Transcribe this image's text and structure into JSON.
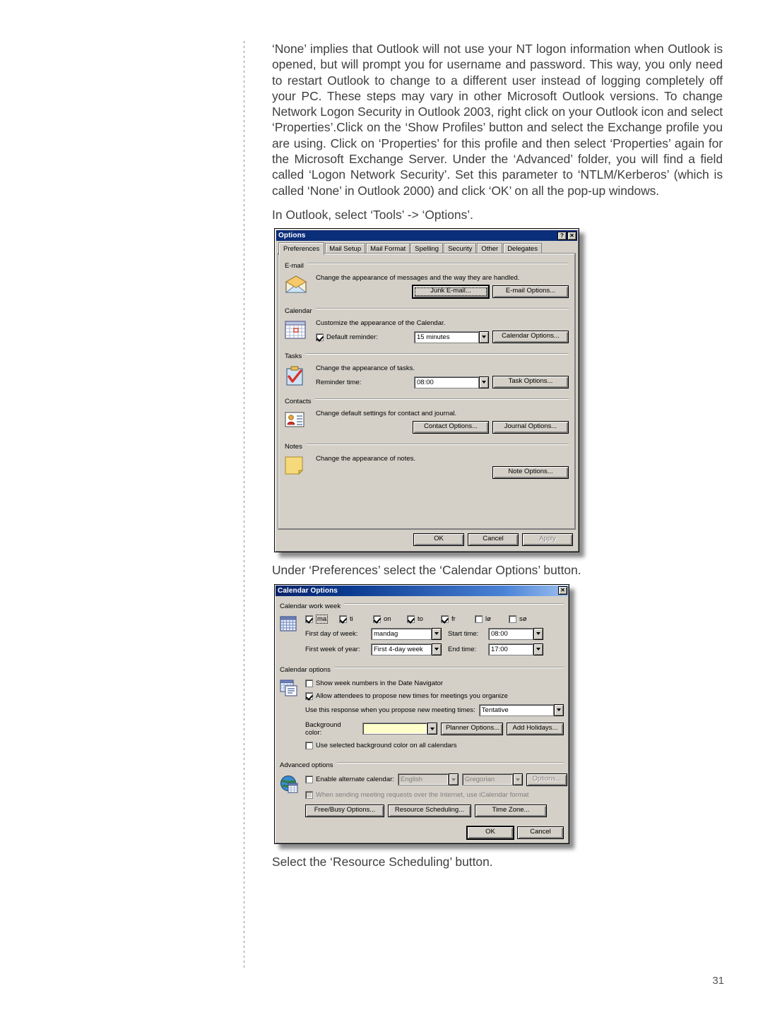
{
  "page": {
    "number": "31",
    "paragraphs": [
      "‘None’ implies that Outlook will not use your NT logon information when Outlook is opened, but will prompt you for username and password. This way, you only need to restart Outlook to change to a different user instead of logging completely off your PC. These steps may vary in other Microsoft Outlook versions. To change Network Logon Security in Outlook 2003, right click on your Outlook icon and select ‘Properties’.Click on the ‘Show Profiles’ button and select the Exchange profile you are using. Click on ‘Properties’ for this profile and then select ‘Properties’ again for the Microsoft Exchange Server. Under the ‘Advanced’ folder, you will find a field called ‘Logon Network Security’. Set this parameter to ‘NTLM/Kerberos’ (which is called ‘None’ in Outlook 2000) and click ‘OK’ on all the pop-up windows."
    ],
    "caption_before_options": "In Outlook, select ‘Tools’ -> ‘Options’.",
    "caption_between": "Under ‘Preferences’ select the ‘Calendar Options’ button.",
    "caption_after": "Select the ‘Resource Scheduling’ button."
  },
  "colors": {
    "title_navy": "#0b2e7a",
    "title_gradient_start": "#0a246a",
    "title_gradient_end": "#9cc0f0",
    "dialog_face": "#d4d0c8",
    "background_color_swatch": "#ffffcc"
  },
  "options_dialog": {
    "title": "Options",
    "titlebar_buttons": [
      {
        "name": "help-button",
        "glyph": "?"
      },
      {
        "name": "close-button",
        "glyph": "✕"
      }
    ],
    "tabs": [
      {
        "label": "Preferences",
        "selected": true
      },
      {
        "label": "Mail Setup",
        "selected": false
      },
      {
        "label": "Mail Format",
        "selected": false
      },
      {
        "label": "Spelling",
        "selected": false
      },
      {
        "label": "Security",
        "selected": false
      },
      {
        "label": "Other",
        "selected": false
      },
      {
        "label": "Delegates",
        "selected": false
      }
    ],
    "email": {
      "group_label": "E-mail",
      "description": "Change the appearance of messages and the way they are handled.",
      "junk_button": "Junk E-mail...",
      "email_options_button": "E-mail Options..."
    },
    "calendar": {
      "group_label": "Calendar",
      "description": "Customize the appearance of the Calendar.",
      "default_reminder_label": "Default reminder:",
      "default_reminder_checked": true,
      "default_reminder_value": "15 minutes",
      "calendar_options_button": "Calendar Options..."
    },
    "tasks": {
      "group_label": "Tasks",
      "description": "Change the appearance of tasks.",
      "reminder_time_label": "Reminder time:",
      "reminder_time_value": "08:00",
      "task_options_button": "Task Options..."
    },
    "contacts": {
      "group_label": "Contacts",
      "description": "Change default settings for contact and journal.",
      "contact_options_button": "Contact Options...",
      "journal_options_button": "Journal Options..."
    },
    "notes": {
      "group_label": "Notes",
      "description": "Change the appearance of notes.",
      "note_options_button": "Note Options..."
    },
    "footer": {
      "ok": "OK",
      "cancel": "Cancel",
      "apply": "Apply",
      "apply_disabled": true
    }
  },
  "calendar_options_dialog": {
    "title": "Calendar Options",
    "titlebar_buttons": [
      {
        "name": "close-button",
        "glyph": "✕"
      }
    ],
    "work_week": {
      "group_label": "Calendar work week",
      "days": [
        {
          "label": "ma",
          "checked": true,
          "focused": true
        },
        {
          "label": "ti",
          "checked": true,
          "focused": false
        },
        {
          "label": "on",
          "checked": true,
          "focused": false
        },
        {
          "label": "to",
          "checked": true,
          "focused": false
        },
        {
          "label": "fr",
          "checked": true,
          "focused": false
        },
        {
          "label": "lø",
          "checked": false,
          "focused": false
        },
        {
          "label": "sø",
          "checked": false,
          "focused": false
        }
      ],
      "first_day_label": "First day of week:",
      "first_day_value": "mandag",
      "start_time_label": "Start time:",
      "start_time_value": "08:00",
      "first_week_label": "First week of year:",
      "first_week_value": "First 4-day week",
      "end_time_label": "End time:",
      "end_time_value": "17:00"
    },
    "calendar_options": {
      "group_label": "Calendar options",
      "show_week_numbers_label": "Show week numbers in the Date Navigator",
      "show_week_numbers_checked": false,
      "allow_attendees_label": "Allow attendees to propose new times for meetings you organize",
      "allow_attendees_checked": true,
      "response_label": "Use this response when you propose new meeting times:",
      "response_value": "Tentative",
      "background_color_label": "Background color:",
      "background_color_value": "",
      "planner_options_button": "Planner Options...",
      "add_holidays_button": "Add Holidays...",
      "use_selected_bg_label": "Use selected background color on all calendars",
      "use_selected_bg_checked": false
    },
    "advanced_options": {
      "group_label": "Advanced options",
      "enable_alternate_label": "Enable alternate calendar:",
      "enable_alternate_checked": false,
      "alternate_language_value": "English",
      "alternate_system_value": "Gregorian",
      "alternate_options_button": "Options...",
      "icalendar_label": "When sending meeting requests over the Internet, use iCalendar format",
      "icalendar_checked": false,
      "free_busy_button": "Free/Busy Options...",
      "resource_scheduling_button": "Resource Scheduling...",
      "time_zone_button": "Time Zone...",
      "ok": "OK",
      "cancel": "Cancel"
    }
  }
}
